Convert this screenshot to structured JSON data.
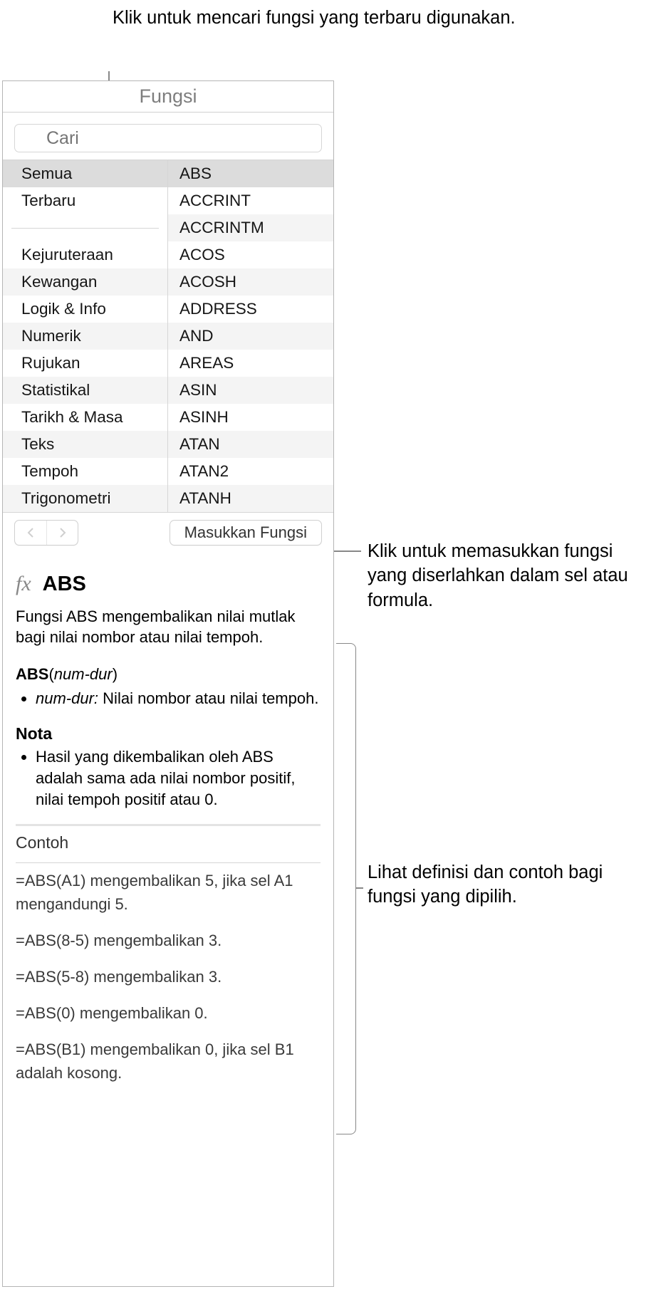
{
  "callouts": {
    "top": "Klik untuk mencari fungsi yang terbaru digunakan.",
    "right1": "Klik untuk memasukkan fungsi yang diserlahkan dalam sel atau formula.",
    "right2": "Lihat definisi dan contoh bagi fungsi yang dipilih."
  },
  "panel": {
    "title": "Fungsi",
    "search_placeholder": "Cari"
  },
  "categories": [
    "Semua",
    "Terbaru",
    "__sep__",
    "Kejuruteraan",
    "Kewangan",
    "Logik & Info",
    "Numerik",
    "Rujukan",
    "Statistikal",
    "Tarikh & Masa",
    "Teks",
    "Tempoh",
    "Trigonometri"
  ],
  "functions": [
    "ABS",
    "ACCRINT",
    "ACCRINTM",
    "ACOS",
    "ACOSH",
    "ADDRESS",
    "AND",
    "AREAS",
    "ASIN",
    "ASINH",
    "ATAN",
    "ATAN2",
    "ATANH"
  ],
  "toolbar": {
    "insert_label": "Masukkan Fungsi"
  },
  "detail": {
    "fx_symbol": "fx",
    "name": "ABS",
    "description": "Fungsi ABS mengembalikan nilai mutlak bagi nilai nombor atau nilai tempoh.",
    "syntax_fn": "ABS",
    "syntax_arg": "num-dur",
    "param_name": "num-dur:",
    "param_desc": "Nilai nombor atau nilai tempoh.",
    "notes_heading": "Nota",
    "note_text": "Hasil yang dikembalikan oleh ABS adalah sama ada nilai nombor positif, nilai tempoh positif atau 0.",
    "examples_heading": "Contoh",
    "examples": [
      "=ABS(A1) mengembalikan 5, jika sel A1 mengandungi 5.",
      "=ABS(8-5) mengembalikan 3.",
      "=ABS(5-8) mengembalikan 3.",
      "=ABS(0) mengembalikan 0.",
      "=ABS(B1) mengembalikan 0, jika sel B1 adalah kosong."
    ]
  }
}
